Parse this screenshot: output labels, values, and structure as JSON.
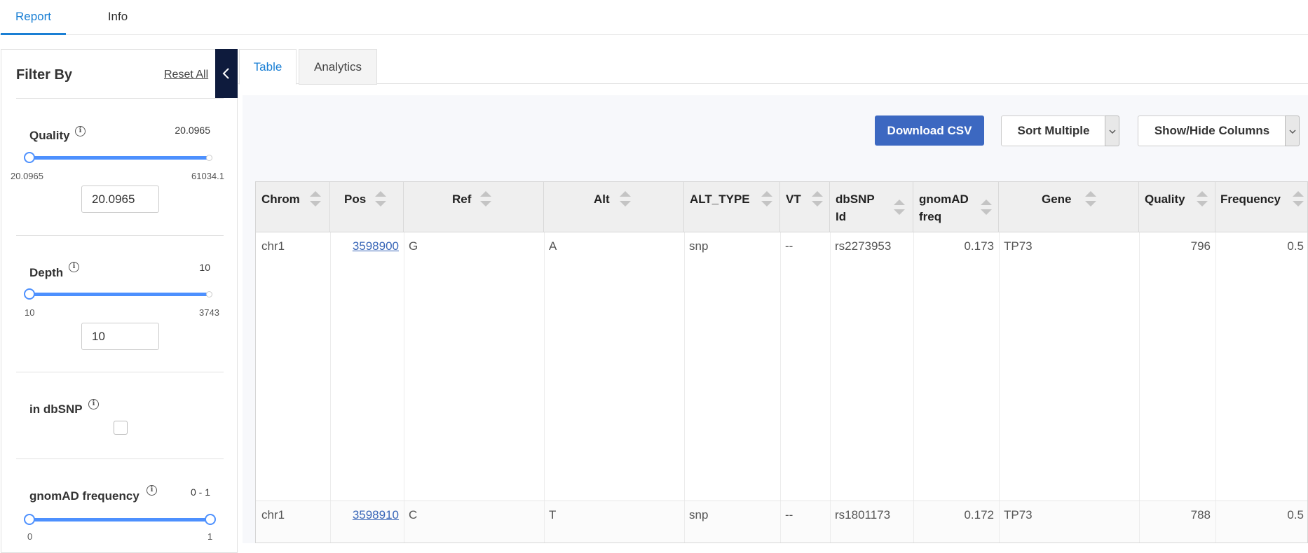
{
  "top_tabs": [
    {
      "label": "Report"
    },
    {
      "label": "Info"
    }
  ],
  "sidebar": {
    "title": "Filter By",
    "reset_label": "Reset All",
    "quality": {
      "label": "Quality",
      "value_display": "20.0965",
      "min": "20.0965",
      "max": "61034.1",
      "input": "20.0965"
    },
    "depth": {
      "label": "Depth",
      "value_display": "10",
      "min": "10",
      "max": "3743",
      "input": "10"
    },
    "dbsnp": {
      "label": "in dbSNP",
      "checked": false
    },
    "gnomad": {
      "label": "gnomAD frequency",
      "value_display": "0 - 1",
      "min": "0",
      "max": "1"
    }
  },
  "main_tabs": [
    {
      "label": "Table"
    },
    {
      "label": "Analytics"
    }
  ],
  "toolbar": {
    "download": "Download CSV",
    "sort": "Sort Multiple",
    "columns": "Show/Hide Columns"
  },
  "table": {
    "headers": [
      {
        "l1": "Chrom",
        "l2": ""
      },
      {
        "l1": "Pos",
        "l2": ""
      },
      {
        "l1": "Ref",
        "l2": ""
      },
      {
        "l1": "Alt",
        "l2": ""
      },
      {
        "l1": "ALT_TYPE",
        "l2": ""
      },
      {
        "l1": "VT",
        "l2": ""
      },
      {
        "l1": "dbSNP",
        "l2": "Id"
      },
      {
        "l1": "gnomAD",
        "l2": "freq"
      },
      {
        "l1": "Gene",
        "l2": ""
      },
      {
        "l1": "Quality",
        "l2": ""
      },
      {
        "l1": "Frequency",
        "l2": ""
      }
    ],
    "rows": [
      [
        "chr1",
        "3598900",
        "G",
        "A",
        "snp",
        "--",
        "rs2273953",
        "0.173",
        "TP73",
        "796",
        "0.5"
      ],
      [
        "chr1",
        "3598910",
        "C",
        "T",
        "snp",
        "--",
        "rs1801173",
        "0.172",
        "TP73",
        "788",
        "0.5"
      ]
    ]
  },
  "colors": {
    "accent": "#1a7fd4",
    "primary_button": "#3c68c1",
    "collapse_button": "#0e1b3d",
    "slider": "#4d90fe"
  }
}
